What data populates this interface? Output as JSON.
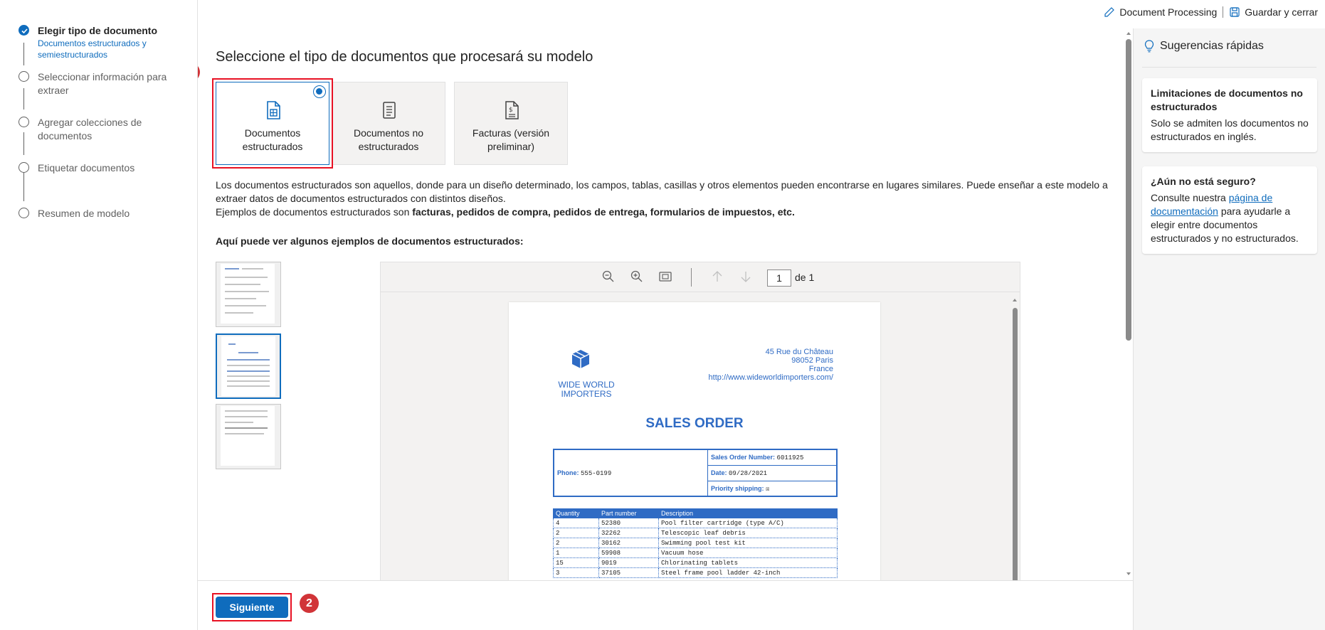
{
  "stepper": {
    "steps": [
      {
        "label": "Elegir tipo de documento",
        "sub": "Documentos estructurados y semiestructurados"
      },
      {
        "label": "Seleccionar información para extraer"
      },
      {
        "label": "Agregar colecciones de documentos"
      },
      {
        "label": "Etiquetar documentos"
      },
      {
        "label": "Resumen de modelo"
      }
    ]
  },
  "topbar": {
    "model_name": "Document Processing",
    "save_close": "Guardar y cerrar"
  },
  "main": {
    "heading": "Seleccione el tipo de documentos que procesará su modelo",
    "doc_types": [
      {
        "label": "Documentos estructurados",
        "icon": "structured-document-icon",
        "selected": true
      },
      {
        "label": "Documentos no estructurados",
        "icon": "unstructured-document-icon",
        "selected": false
      },
      {
        "label": "Facturas (versión preliminar)",
        "icon": "invoice-icon",
        "selected": false
      }
    ],
    "description_line1": "Los documentos estructurados son aquellos, donde para un diseño determinado, los campos, tablas, casillas y otros elementos pueden encontrarse en lugares similares. Puede enseñar a este modelo a extraer datos de documentos estructurados con distintos diseños.",
    "description_line2_prefix": "Ejemplos de documentos estructurados son ",
    "description_line2_bold": "facturas, pedidos de compra, pedidos de entrega, formularios de impuestos, etc.",
    "examples_label": "Aquí puede ver algunos ejemplos de documentos estructurados:",
    "annotations": [
      "1",
      "2"
    ]
  },
  "viewer": {
    "page_current": "1",
    "page_of": "de 1",
    "doc": {
      "company": "WIDE WORLD IMPORTERS",
      "address_line1": "45 Rue du Château",
      "address_line2": "98052 Paris",
      "address_line3": "France",
      "website": "http://www.wideworldimporters.com/",
      "title": "SALES ORDER",
      "phone_label": "Phone:",
      "phone_value": "555-0199",
      "order_number_label": "Sales Order Number:",
      "order_number_value": "6011925",
      "date_label": "Date:",
      "date_value": "09/28/2021",
      "priority_label": "Priority shipping:",
      "priority_value": "☒",
      "columns": [
        "Quantity",
        "Part number",
        "Description"
      ],
      "rows": [
        [
          "4",
          "52380",
          "Pool filter cartridge (type A/C)"
        ],
        [
          "2",
          "32262",
          "Telescopic leaf debris"
        ],
        [
          "2",
          "30162",
          "Swimming pool test kit"
        ],
        [
          "1",
          "59908",
          "Vacuum hose"
        ],
        [
          "15",
          "9019",
          "Chlorinating tablets"
        ],
        [
          "3",
          "37105",
          "Steel frame pool ladder 42-inch"
        ]
      ]
    }
  },
  "footer": {
    "next_label": "Siguiente"
  },
  "tips": {
    "title": "Sugerencias rápidas",
    "card1_title": "Limitaciones de documentos no estructurados",
    "card1_body": "Solo se admiten los documentos no estructurados en inglés.",
    "card2_title": "¿Aún no está seguro?",
    "card2_prefix": "Consulte nuestra ",
    "card2_link": "página de documentación",
    "card2_suffix": " para ayudarle a elegir entre documentos estructurados y no estructurados."
  },
  "colors": {
    "accent": "#0f6cbd",
    "annotation_red": "#e81123",
    "doc_blue": "#2f6bc4"
  }
}
